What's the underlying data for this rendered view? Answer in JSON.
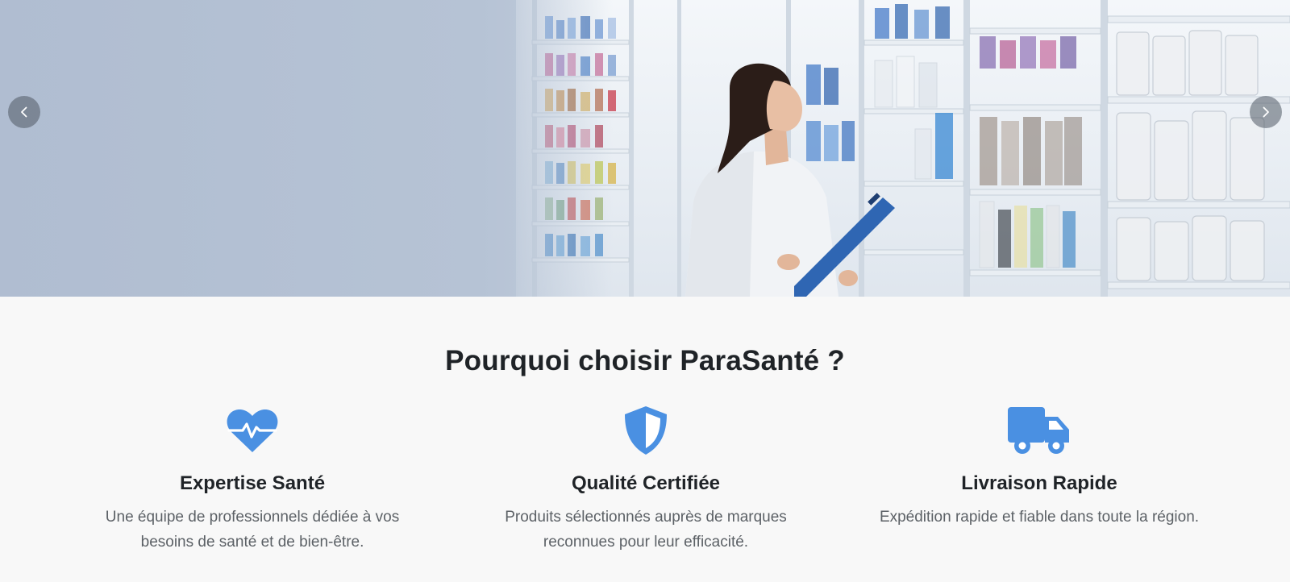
{
  "hero": {
    "prev_label": "Previous",
    "next_label": "Next",
    "prev_icon": "chevron-left-icon",
    "next_icon": "chevron-right-icon"
  },
  "why": {
    "title": "Pourquoi choisir ParaSanté ?",
    "features": [
      {
        "icon": "heart-pulse-icon",
        "title": "Expertise Santé",
        "description": "Une équipe de professionnels dédiée à vos besoins de santé et de bien-être."
      },
      {
        "icon": "shield-icon",
        "title": "Qualité Certifiée",
        "description": "Produits sélectionnés auprès de marques reconnues pour leur efficacité."
      },
      {
        "icon": "truck-icon",
        "title": "Livraison Rapide",
        "description": "Expédition rapide et fiable dans toute la région."
      }
    ]
  },
  "colors": {
    "accent": "#4a90e2",
    "heading": "#1f2327",
    "text": "#5c6166",
    "background": "#f8f8f8"
  }
}
